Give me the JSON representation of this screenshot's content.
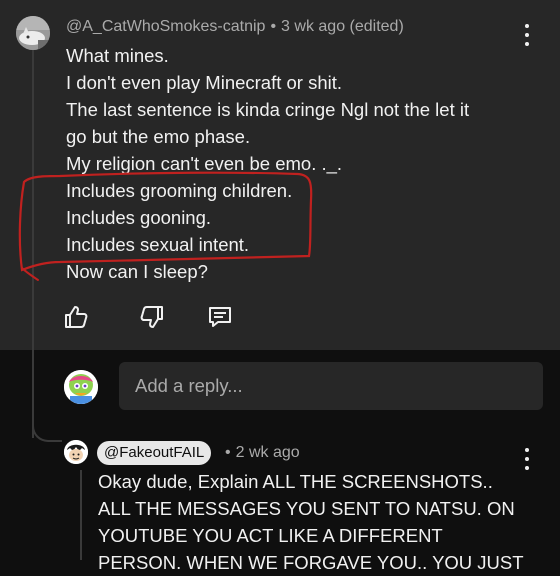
{
  "comment": {
    "author": "@A_CatWhoSmokes-catnip",
    "separator": "•",
    "timestamp": "3 wk ago (edited)",
    "lines": [
      "What mines.",
      "I don't even play Minecraft or shit.",
      "The last sentence is kinda cringe Ngl not the let it",
      "go but the emo phase.",
      "My religion can't even be emo. ._.",
      "Includes grooming children.",
      "Includes gooning.",
      "Includes sexual intent.",
      "Now can I sleep?"
    ],
    "actions": {
      "like_icon": "thumbs-up-icon",
      "dislike_icon": "thumbs-down-icon",
      "reply_icon": "comment-reply-icon"
    },
    "annotation_color": "#c0211f"
  },
  "reply_box": {
    "placeholder": "Add a reply..."
  },
  "reply": {
    "author": "@FakeoutFAIL",
    "separator": "•",
    "timestamp": "2 wk ago",
    "lines": [
      "Okay dude, Explain ALL THE SCREENSHOTS..",
      "ALL THE MESSAGES YOU SENT TO NATSU. ON",
      "YOUTUBE YOU ACT LIKE A DIFFERENT",
      "PERSON. WHEN WE FORGAVE YOU.. YOU JUST"
    ]
  },
  "colors": {
    "panel_bg": "#272727",
    "page_bg": "#0f0f0f",
    "text_primary": "#f1f1f1",
    "text_secondary": "#aaaaaa"
  }
}
